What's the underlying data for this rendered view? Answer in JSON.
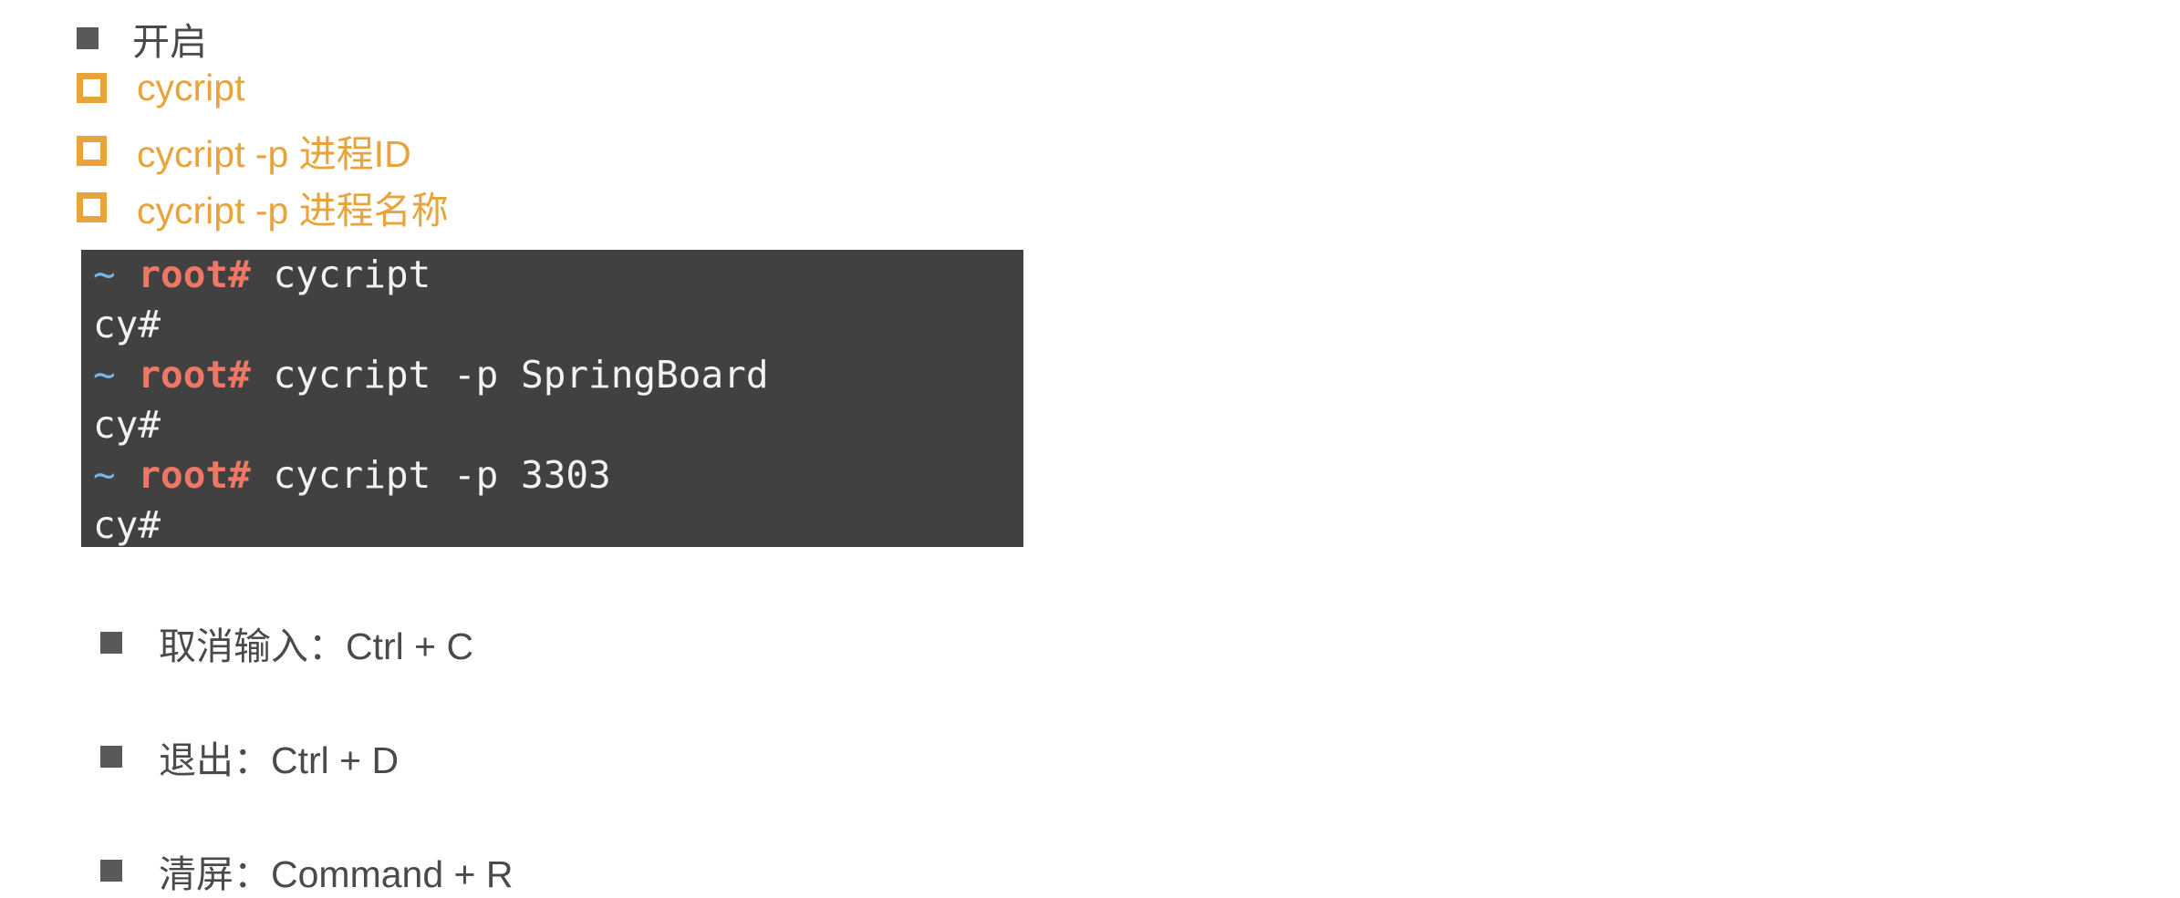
{
  "top_list": {
    "item": "开启"
  },
  "sub_list": [
    "cycript",
    "cycript -p 进程ID",
    "cycript -p 进程名称"
  ],
  "terminal": {
    "lines": [
      {
        "prompt_tilde": "~",
        "prompt_user": "root#",
        "command": " cycript"
      },
      {
        "output": "cy#"
      },
      {
        "prompt_tilde": "~",
        "prompt_user": "root#",
        "command": " cycript -p SpringBoard"
      },
      {
        "output": "cy#"
      },
      {
        "prompt_tilde": "~",
        "prompt_user": "root#",
        "command": " cycript -p 3303"
      },
      {
        "output": "cy#"
      }
    ]
  },
  "shortcuts": [
    "取消输入：Ctrl + C",
    "退出：Ctrl + D",
    "清屏：Command + R"
  ],
  "colors": {
    "accent_orange": "#e8a33a",
    "terminal_bg": "#414141",
    "prompt_tilde": "#79b6e8",
    "prompt_root": "#ef7766",
    "body_text": "#4a4a4a"
  }
}
